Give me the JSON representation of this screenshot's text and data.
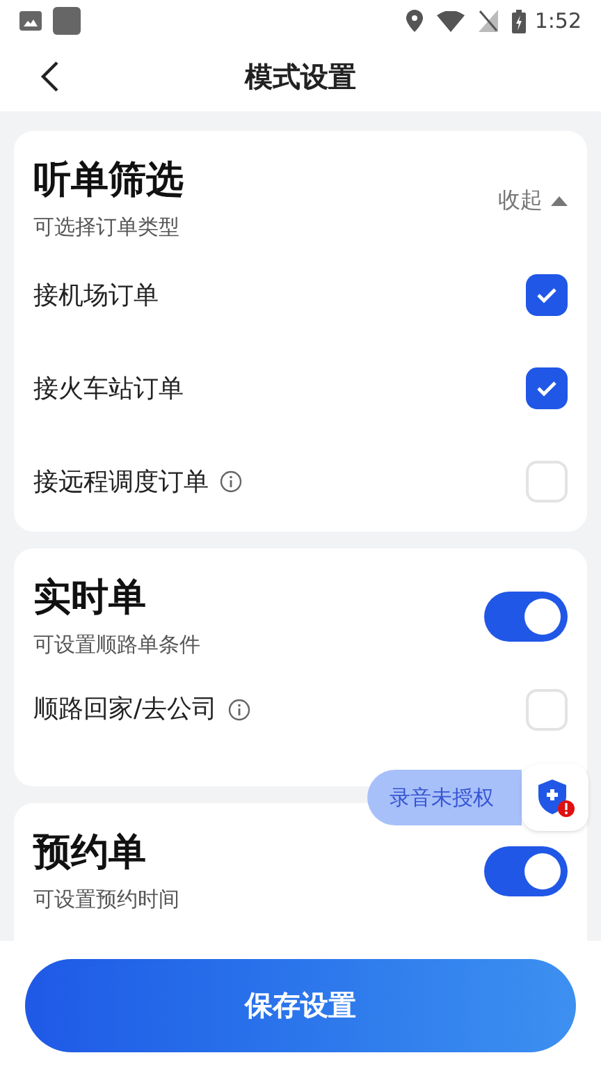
{
  "status_bar": {
    "time": "1:52"
  },
  "header": {
    "title": "模式设置"
  },
  "filter_card": {
    "title": "听单筛选",
    "subtitle": "可选择订单类型",
    "collapse": "收起",
    "expanded": true,
    "options": [
      {
        "label": "接机场订单",
        "info": false,
        "checked": true
      },
      {
        "label": "接火车站订单",
        "info": false,
        "checked": true
      },
      {
        "label": "接远程调度订单",
        "info": true,
        "checked": false
      }
    ]
  },
  "realtime_card": {
    "title": "实时单",
    "subtitle": "可设置顺路单条件",
    "on": true,
    "options": [
      {
        "label": "顺路回家/去公司",
        "info": true,
        "checked": false
      }
    ]
  },
  "booking_card": {
    "title": "预约单",
    "subtitle": "可设置预约时间",
    "on": true
  },
  "floating_badge": {
    "label": "录音未授权"
  },
  "save_button": {
    "label": "保存设置"
  }
}
